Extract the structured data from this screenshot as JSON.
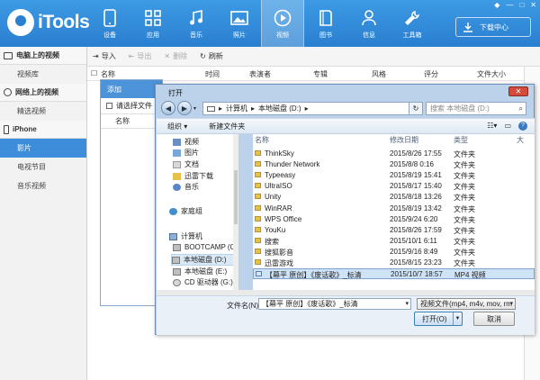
{
  "app": {
    "name": "iTools",
    "download_center": "下载中心"
  },
  "window_controls": {
    "pin": "◆",
    "minimize": "—",
    "maximize": "□",
    "close": "✕"
  },
  "nav": [
    {
      "label": "设备",
      "icon": "phone-icon"
    },
    {
      "label": "应用",
      "icon": "apps-icon"
    },
    {
      "label": "音乐",
      "icon": "music-icon"
    },
    {
      "label": "照片",
      "icon": "photo-icon"
    },
    {
      "label": "视频",
      "icon": "video-icon",
      "active": true
    },
    {
      "label": "图书",
      "icon": "book-icon"
    },
    {
      "label": "信息",
      "icon": "contact-icon"
    },
    {
      "label": "工具箱",
      "icon": "toolbox-icon"
    }
  ],
  "sidebar": {
    "sections": [
      {
        "title": "电脑上的视频",
        "items": [
          "视频库"
        ]
      },
      {
        "title": "网络上的视频",
        "items": [
          "精选视频"
        ]
      },
      {
        "title": "iPhone",
        "items": [
          "影片",
          "电视节目",
          "音乐视频"
        ]
      }
    ],
    "active_item": "影片"
  },
  "toolbar": {
    "import": "导入",
    "export": "导出",
    "delete": "删除",
    "refresh": "刷新"
  },
  "columns": [
    "名称",
    "时间",
    "表演者",
    "专辑",
    "风格",
    "评分",
    "文件大小"
  ],
  "add_window": {
    "title": "添加",
    "select_file": "请选择文件",
    "col_name": "名称"
  },
  "dialog": {
    "title": "打开",
    "close": "✕",
    "address": [
      "计算机",
      "本地磁盘 (D:)"
    ],
    "search_placeholder": "搜索 本地磁盘 (D:)",
    "organize": "组织 ▾",
    "new_folder": "新建文件夹",
    "nav_items": [
      {
        "label": "视频",
        "icon": "video-folder-icon"
      },
      {
        "label": "图片",
        "icon": "picture-folder-icon"
      },
      {
        "label": "文档",
        "icon": "document-folder-icon"
      },
      {
        "label": "迅雷下载",
        "icon": "download-folder-icon"
      },
      {
        "label": "音乐",
        "icon": "music-folder-icon"
      },
      {
        "label": "家庭组",
        "icon": "homegroup-icon"
      },
      {
        "label": "计算机",
        "icon": "computer-icon"
      },
      {
        "label": "BOOTCAMP (C:",
        "icon": "drive-icon"
      },
      {
        "label": "本地磁盘 (D:)",
        "icon": "drive-icon"
      },
      {
        "label": "本地磁盘 (E:)",
        "icon": "drive-icon"
      },
      {
        "label": "CD 驱动器 (G:)",
        "icon": "cd-drive-icon"
      }
    ],
    "headers": {
      "name": "名称",
      "date": "修改日期",
      "type": "类型",
      "size": "大"
    },
    "files": [
      {
        "name": "ThinkSky",
        "date": "2015/8/26 17:55",
        "type": "文件夹"
      },
      {
        "name": "Thunder Network",
        "date": "2015/8/8 0:16",
        "type": "文件夹"
      },
      {
        "name": "Typeeasy",
        "date": "2015/8/19 15:41",
        "type": "文件夹"
      },
      {
        "name": "UltraISO",
        "date": "2015/8/17 15:40",
        "type": "文件夹"
      },
      {
        "name": "Unity",
        "date": "2015/8/18 13:26",
        "type": "文件夹"
      },
      {
        "name": "WinRAR",
        "date": "2015/8/19 13:42",
        "type": "文件夹"
      },
      {
        "name": "WPS Office",
        "date": "2015/9/24 6:20",
        "type": "文件夹"
      },
      {
        "name": "YouKu",
        "date": "2015/8/26 17:59",
        "type": "文件夹"
      },
      {
        "name": "搜索",
        "date": "2015/10/1 6:11",
        "type": "文件夹"
      },
      {
        "name": "搜狐影音",
        "date": "2015/9/16 8:49",
        "type": "文件夹"
      },
      {
        "name": "迅雷游戏",
        "date": "2015/8/15 23:23",
        "type": "文件夹"
      },
      {
        "name": "【幕平 原创】《废话歌》_标清",
        "date": "2015/10/7 18:57",
        "type": "MP4 视频",
        "selected": true
      }
    ],
    "filename_label": "文件名(N):",
    "filename_value": "【幕平 原创】《废话歌》_标清",
    "filetype": "视频文件(mp4, m4v, mov, rm",
    "open": "打开(O)",
    "cancel": "取消"
  }
}
